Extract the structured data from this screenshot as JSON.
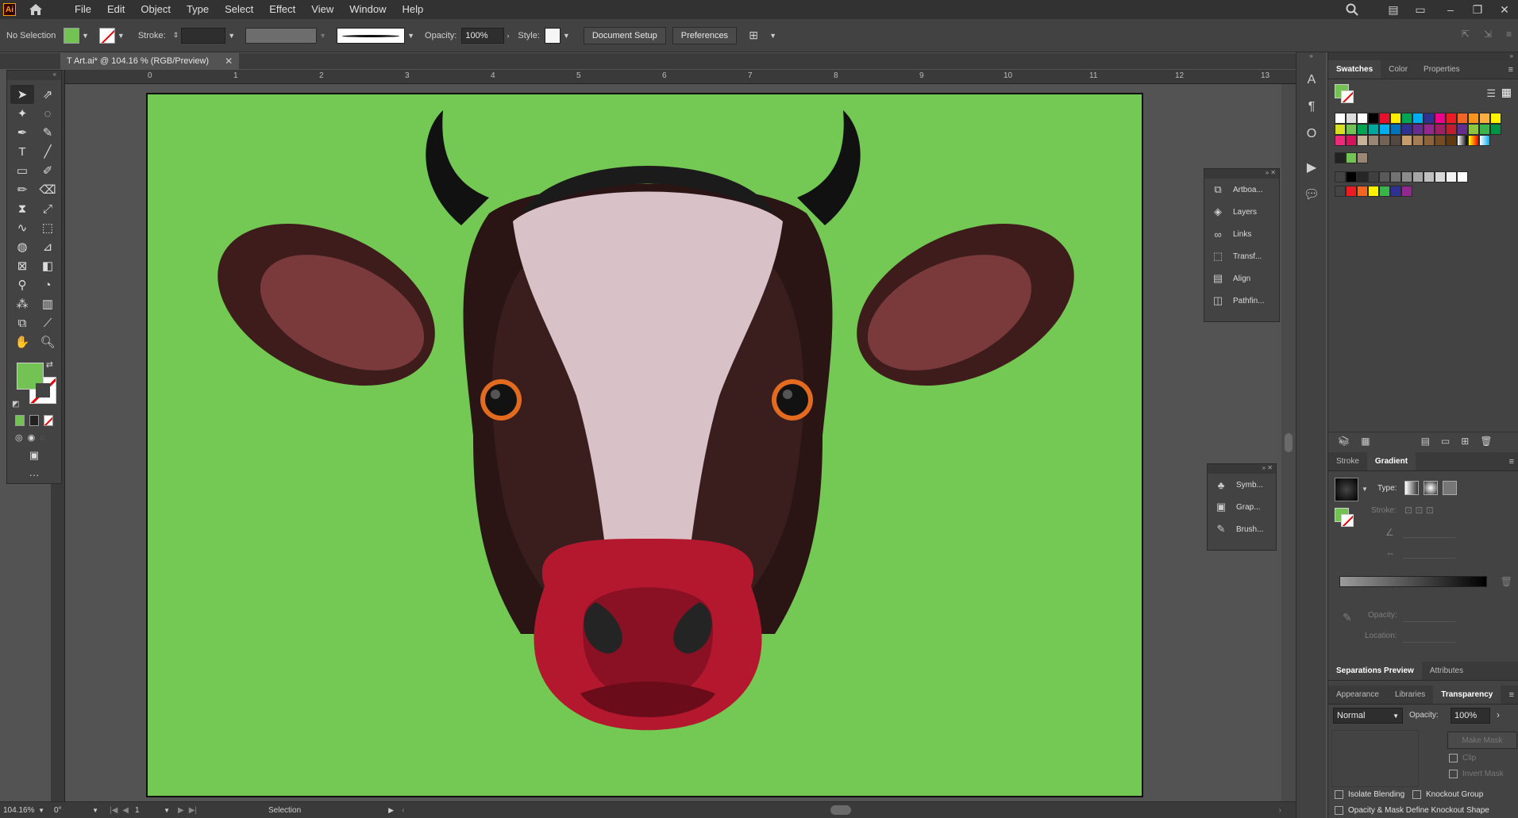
{
  "app": {
    "logo": "Ai",
    "menu": [
      "File",
      "Edit",
      "Object",
      "Type",
      "Select",
      "Effect",
      "View",
      "Window",
      "Help"
    ]
  },
  "controlbar": {
    "selection": "No Selection",
    "stroke_label": "Stroke:",
    "opacity_label": "Opacity:",
    "opacity_value": "100%",
    "style_label": "Style:",
    "document_setup": "Document Setup",
    "preferences": "Preferences"
  },
  "document": {
    "tab_title": "T Art.ai* @ 104.16 % (RGB/Preview)",
    "background_color": "#74c854"
  },
  "ruler": {
    "labels": [
      "0",
      "1",
      "2",
      "3",
      "4",
      "5",
      "6",
      "7",
      "8",
      "9",
      "10",
      "11",
      "12",
      "13"
    ]
  },
  "float_panel_1": {
    "items": [
      "Artboa...",
      "Layers",
      "Links",
      "Transf...",
      "Align",
      "Pathfin..."
    ]
  },
  "float_panel_2": {
    "items": [
      "Symb...",
      "Grap...",
      "Brush..."
    ]
  },
  "dock": {
    "tabs1": [
      "Swatches",
      "Color",
      "Properties"
    ],
    "tabs2": [
      "Stroke",
      "Gradient"
    ],
    "gradient": {
      "type_label": "Type:",
      "stroke_label": "Stroke:",
      "opacity_label": "Opacity:",
      "location_label": "Location:"
    },
    "tabs3": [
      "Separations Preview",
      "Attributes"
    ],
    "tabs4": [
      "Appearance",
      "Libraries",
      "Transparency"
    ],
    "transparency": {
      "blend_mode": "Normal",
      "opacity_label": "Opacity:",
      "opacity_value": "100%",
      "make_mask": "Make Mask",
      "clip": "Clip",
      "invert_mask": "Invert Mask",
      "isolate_blending": "Isolate Blending",
      "knockout_group": "Knockout Group",
      "opacity_mask": "Opacity & Mask Define Knockout Shape"
    }
  },
  "statusbar": {
    "zoom": "104.16%",
    "rotation": "0°",
    "artboard": "1",
    "tool": "Selection"
  },
  "colors": {
    "fill": "#72c254",
    "accent": "#ff9a00"
  }
}
